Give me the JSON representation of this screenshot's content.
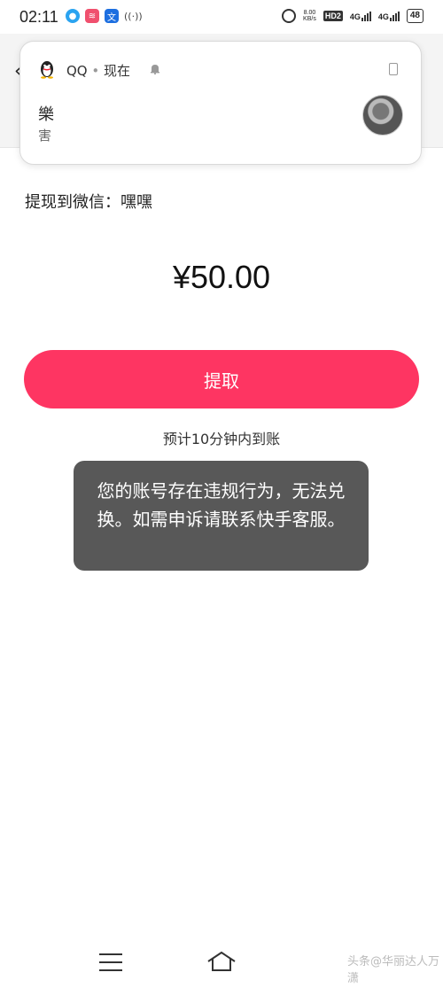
{
  "status_bar": {
    "time": "02:11",
    "app_icons": [
      {
        "name": "qq-icon",
        "glyph": "●"
      },
      {
        "name": "red-app-icon",
        "glyph": "≋"
      },
      {
        "name": "translate-app-icon",
        "glyph": "文"
      },
      {
        "name": "hotspot-icon",
        "glyph": "((·))"
      }
    ],
    "net_speed_value": "8.00",
    "net_speed_unit": "KB/s",
    "hd_label": "HD2",
    "network_1": "4G",
    "network_2": "4G",
    "battery": "48"
  },
  "notification": {
    "app_name": "QQ",
    "separator": "•",
    "time": "现在",
    "sender": "樂",
    "message": "害"
  },
  "page": {
    "withdraw_to": "提现到微信：嘿嘿",
    "amount": "¥50.00",
    "withdraw_button": "提取",
    "eta": "预计10分钟内到账"
  },
  "toast": {
    "message": "您的账号存在违规行为，无法兑换。如需申诉请联系快手客服。"
  },
  "watermark": "头条@华丽达人万潇"
}
